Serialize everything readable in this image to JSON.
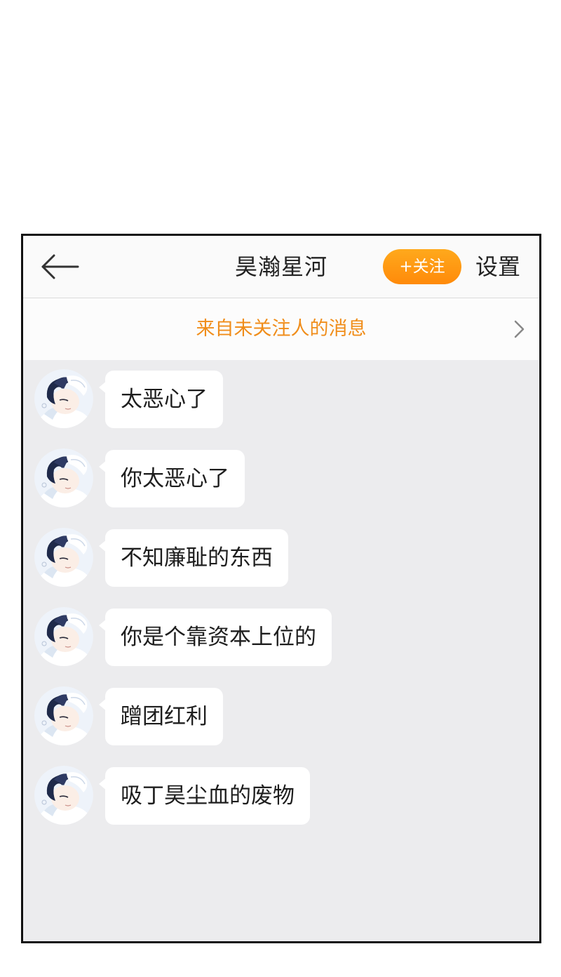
{
  "header": {
    "title": "昊瀚星河",
    "follow_label": "+关注",
    "settings_label": "设置",
    "back_icon": "arrow-left-icon"
  },
  "notice": {
    "text": "来自未关注人的消息",
    "chevron_icon": "chevron-right-icon"
  },
  "messages": [
    {
      "text": "太恶心了"
    },
    {
      "text": "你太恶心了"
    },
    {
      "text": "不知廉耻的东西"
    },
    {
      "text": "你是个靠资本上位的"
    },
    {
      "text": "蹭团红利"
    },
    {
      "text": "吸丁昊尘血的废物"
    }
  ],
  "colors": {
    "accent": "#ff9a14",
    "notice_text": "#f08d1a",
    "chat_background": "#ececee",
    "bubble": "#ffffff"
  }
}
